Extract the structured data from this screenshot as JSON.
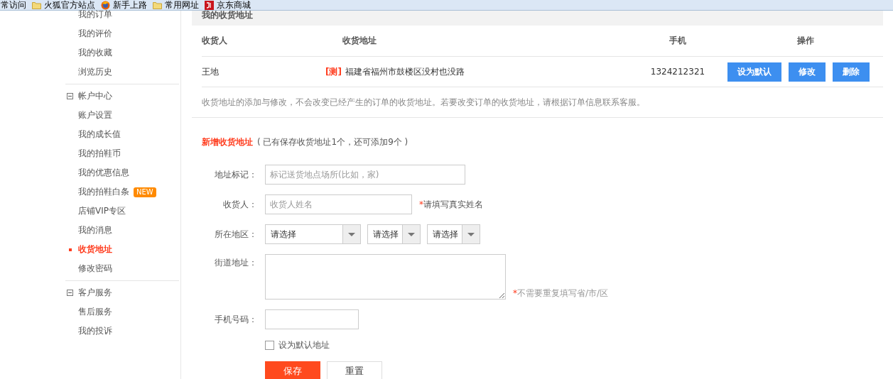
{
  "bookmarks": [
    {
      "label": "常访问",
      "kind": "plain"
    },
    {
      "label": "火狐官方站点",
      "kind": "folder"
    },
    {
      "label": "新手上路",
      "kind": "browser"
    },
    {
      "label": "常用网址",
      "kind": "folder"
    },
    {
      "label": "京东商城",
      "kind": "store"
    }
  ],
  "sidebar": {
    "sections": [
      {
        "items": [
          {
            "label": "我的订单",
            "selected": false
          },
          {
            "label": "我的评价",
            "selected": false
          },
          {
            "label": "我的收藏",
            "selected": false
          },
          {
            "label": "浏览历史",
            "selected": false
          }
        ]
      },
      {
        "title": "帐户中心",
        "expanded": true,
        "items": [
          {
            "label": "账户设置",
            "selected": false
          },
          {
            "label": "我的成长值",
            "selected": false
          },
          {
            "label": "我的拍鞋币",
            "selected": false
          },
          {
            "label": "我的优惠信息",
            "selected": false
          },
          {
            "label": "我的拍鞋白条",
            "selected": false,
            "badge": "NEW"
          },
          {
            "label": "店铺VIP专区",
            "selected": false
          },
          {
            "label": "我的消息",
            "selected": false
          },
          {
            "label": "收货地址",
            "selected": true
          },
          {
            "label": "修改密码",
            "selected": false
          }
        ]
      },
      {
        "title": "客户服务",
        "expanded": true,
        "items": [
          {
            "label": "售后服务",
            "selected": false
          },
          {
            "label": "我的投诉",
            "selected": false
          }
        ]
      }
    ]
  },
  "address_panel": {
    "title": "我的收货地址",
    "columns": [
      "收货人",
      "收货地址",
      "手机",
      "操作"
    ],
    "rows": [
      {
        "name": "王地",
        "tag": "[测]",
        "address": "福建省福州市鼓楼区没村也没路",
        "phone": "1324212321",
        "actions": [
          "设为默认",
          "修改",
          "删除"
        ]
      }
    ],
    "note": "收货地址的添加与修改，不会改变已经产生的订单的收货地址。若要改变订单的收货地址，请根据订单信息联系客服。"
  },
  "form": {
    "title": "新增收货地址",
    "subtitle": "( 已有保存收货地址1个，还可添加9个 )",
    "fields": [
      {
        "kind": "text",
        "label": "地址标记：",
        "placeholder": "标记送货地点场所(比如，家)"
      },
      {
        "kind": "text",
        "label": "收货人：",
        "placeholder": "收货人姓名",
        "hint_mark": "*",
        "hint": "请填写真实姓名"
      },
      {
        "kind": "select",
        "label": "所在地区：",
        "options": [
          "请选择",
          "请选择",
          "请选择"
        ]
      },
      {
        "kind": "textarea",
        "label": "街道地址：",
        "hint_mark": "*",
        "hint": "不需要重复填写省/市/区"
      },
      {
        "kind": "text",
        "label": "手机号码："
      }
    ],
    "checkbox": {
      "label": "设为默认地址",
      "checked": false
    },
    "buttons": [
      {
        "label": "保存",
        "kind": "primary"
      },
      {
        "label": "重置",
        "kind": "secondary"
      }
    ]
  }
}
